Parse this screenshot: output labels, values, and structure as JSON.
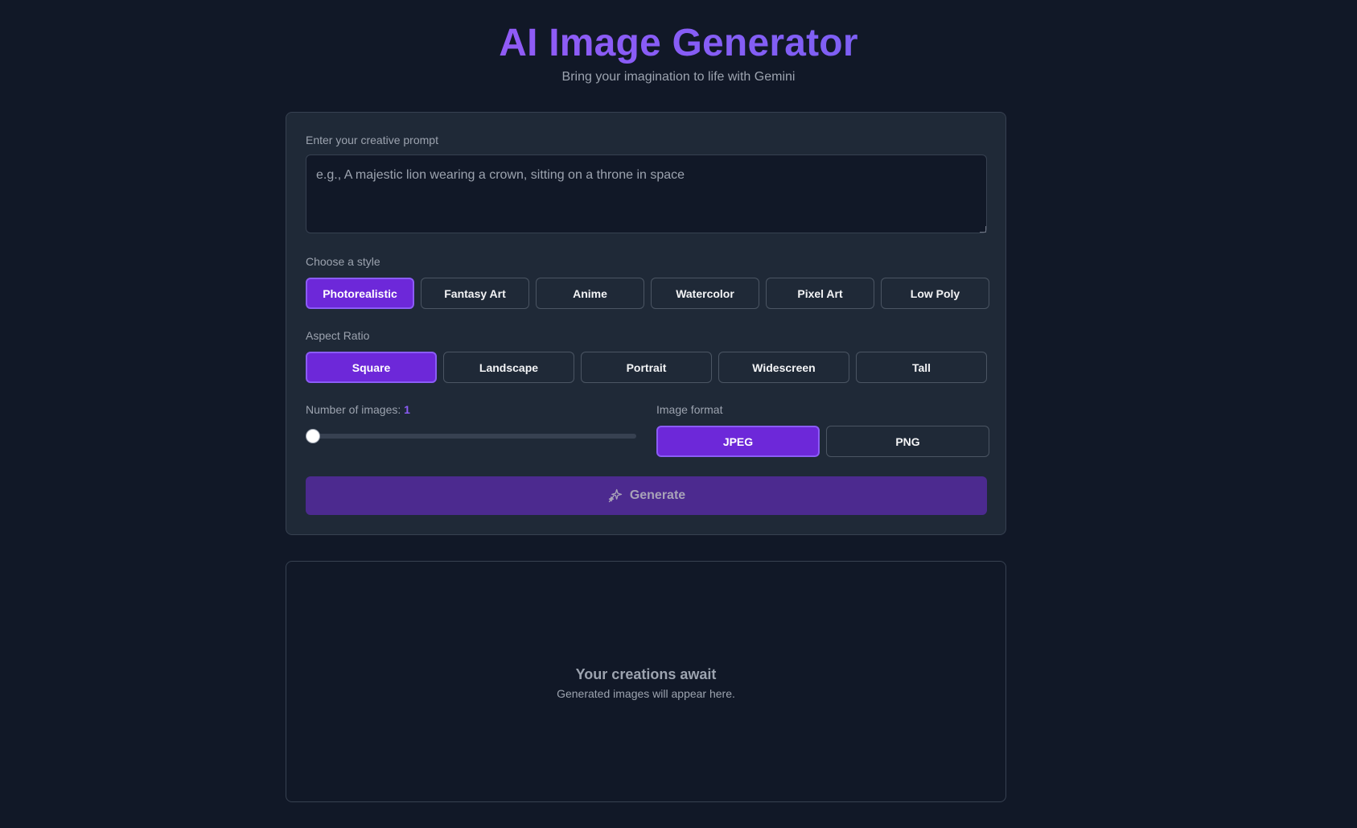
{
  "header": {
    "title": "AI Image Generator",
    "subtitle": "Bring your imagination to life with Gemini"
  },
  "form": {
    "prompt_label": "Enter your creative prompt",
    "prompt_placeholder": "e.g., A majestic lion wearing a crown, sitting on a throne in space",
    "prompt_value": "",
    "style_label": "Choose a style",
    "styles": [
      {
        "label": "Photorealistic",
        "selected": true
      },
      {
        "label": "Fantasy Art",
        "selected": false
      },
      {
        "label": "Anime",
        "selected": false
      },
      {
        "label": "Watercolor",
        "selected": false
      },
      {
        "label": "Pixel Art",
        "selected": false
      },
      {
        "label": "Low Poly",
        "selected": false
      }
    ],
    "aspect_label": "Aspect Ratio",
    "aspect_ratios": [
      {
        "label": "Square",
        "selected": true
      },
      {
        "label": "Landscape",
        "selected": false
      },
      {
        "label": "Portrait",
        "selected": false
      },
      {
        "label": "Widescreen",
        "selected": false
      },
      {
        "label": "Tall",
        "selected": false
      }
    ],
    "count_label": "Number of images:",
    "count_value": "1",
    "format_label": "Image format",
    "formats": [
      {
        "label": "JPEG",
        "selected": true
      },
      {
        "label": "PNG",
        "selected": false
      }
    ],
    "generate_label": "Generate",
    "generate_icon": "sparkles-icon"
  },
  "output": {
    "empty_title": "Your creations await",
    "empty_subtitle": "Generated images will appear here."
  },
  "colors": {
    "background": "#111827",
    "panel": "#1f2937",
    "accent": "#6d28d9",
    "accent_border": "#8b5cf6",
    "generate_bg": "#4c2a8f"
  }
}
